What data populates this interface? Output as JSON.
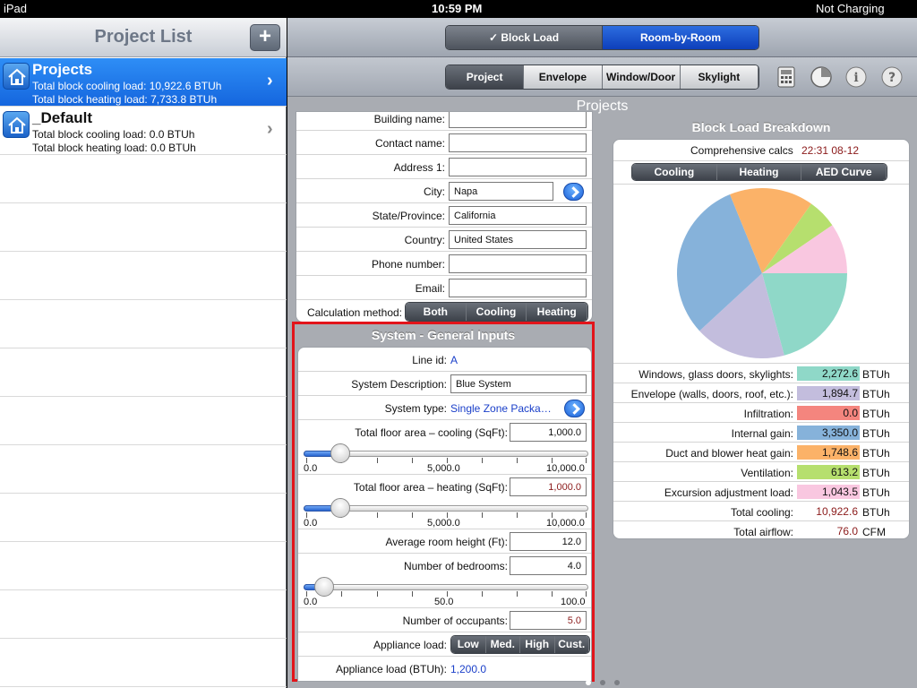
{
  "status": {
    "device": "iPad",
    "time": "10:59 PM",
    "battery": "Not Charging"
  },
  "left": {
    "title": "Project List",
    "add_label": "+",
    "projects": [
      {
        "name": "Projects",
        "line1": "Total block cooling load: 10,922.6 BTUh",
        "line2": "Total block heating load: 7,733.8 BTUh"
      },
      {
        "name": "_Default",
        "line1": "Total block cooling load: 0.0 BTUh",
        "line2": "Total block heating load: 0.0 BTUh"
      }
    ]
  },
  "topseg": {
    "items": [
      "✓ Block Load",
      "Room-by-Room"
    ]
  },
  "navseg": {
    "items": [
      "Project",
      "Envelope",
      "Window/Door",
      "Skylight"
    ]
  },
  "page_title": "Projects",
  "project_form": {
    "fields": [
      {
        "label": "Building name:",
        "value": ""
      },
      {
        "label": "Contact name:",
        "value": ""
      },
      {
        "label": "Address 1:",
        "value": ""
      },
      {
        "label": "City:",
        "value": "Napa"
      },
      {
        "label": "State/Province:",
        "value": "California"
      },
      {
        "label": "Country:",
        "value": "United States"
      },
      {
        "label": "Phone number:",
        "value": ""
      },
      {
        "label": "Email:",
        "value": ""
      }
    ],
    "calc_label": "Calculation method:",
    "calc_options": [
      "Both",
      "Cooling",
      "Heating"
    ]
  },
  "system": {
    "title": "System - General Inputs",
    "line_id_label": "Line id:",
    "line_id": "A",
    "desc_label": "System Description:",
    "desc": "Blue System",
    "type_label": "System type:",
    "type": "Single Zone Packa…",
    "cool_area_label": "Total floor area – cooling (SqFt):",
    "cool_area": "1,000.0",
    "heat_area_label": "Total floor area – heating (SqFt):",
    "heat_area": "1,000.0",
    "area_ticks": [
      "0.0",
      "5,000.0",
      "10,000.0"
    ],
    "cool_area_fraction": 0.1,
    "heat_area_fraction": 0.1,
    "room_height_label": "Average room height (Ft):",
    "room_height": "12.0",
    "bedrooms_label": "Number of bedrooms:",
    "bedrooms": "4.0",
    "bed_ticks": [
      "0.0",
      "50.0",
      "100.0"
    ],
    "bedrooms_fraction": 0.04,
    "occupants_label": "Number of occupants:",
    "occupants": "5.0",
    "appliance_label": "Appliance load:",
    "appliance_options": [
      "Low",
      "Med.",
      "High",
      "Cust."
    ],
    "appliance_btu_label": "Appliance load (BTUh):",
    "appliance_btu": "1,200.0"
  },
  "breakdown": {
    "title": "Block Load Breakdown",
    "calc_label": "Comprehensive calcs",
    "calc_time": "22:31 08-12",
    "tabs": [
      "Cooling",
      "Heating",
      "AED Curve"
    ],
    "rows": [
      {
        "label": "Windows, glass doors, skylights:",
        "value": "2,272.6",
        "unit": "BTUh",
        "color": "#8fd8c8"
      },
      {
        "label": "Envelope (walls, doors, roof, etc.):",
        "value": "1,894.7",
        "unit": "BTUh",
        "color": "#c3bddd"
      },
      {
        "label": "Infiltration:",
        "value": "0.0",
        "unit": "BTUh",
        "color": "#f4857e"
      },
      {
        "label": "Internal gain:",
        "value": "3,350.0",
        "unit": "BTUh",
        "color": "#86b2da"
      },
      {
        "label": "Duct and blower heat gain:",
        "value": "1,748.6",
        "unit": "BTUh",
        "color": "#fbb268"
      },
      {
        "label": "Ventilation:",
        "value": "613.2",
        "unit": "BTUh",
        "color": "#b6df6e"
      },
      {
        "label": "Excursion adjustment load:",
        "value": "1,043.5",
        "unit": "BTUh",
        "color": "#f9c7e0"
      }
    ],
    "total_cooling_label": "Total cooling:",
    "total_cooling": "10,922.6",
    "total_cooling_unit": "BTUh",
    "total_airflow_label": "Total airflow:",
    "total_airflow": "76.0",
    "total_airflow_unit": "CFM"
  },
  "chart_data": {
    "type": "pie",
    "categories": [
      "Windows, glass doors, skylights",
      "Envelope (walls, doors, roof, etc.)",
      "Infiltration",
      "Internal gain",
      "Duct and blower heat gain",
      "Ventilation",
      "Excursion adjustment load"
    ],
    "values": [
      2272.6,
      1894.7,
      0.0,
      3350.0,
      1748.6,
      613.2,
      1043.5
    ],
    "colors": [
      "#8fd8c8",
      "#c3bddd",
      "#f4857e",
      "#86b2da",
      "#fbb268",
      "#b6df6e",
      "#f9c7e0"
    ]
  }
}
